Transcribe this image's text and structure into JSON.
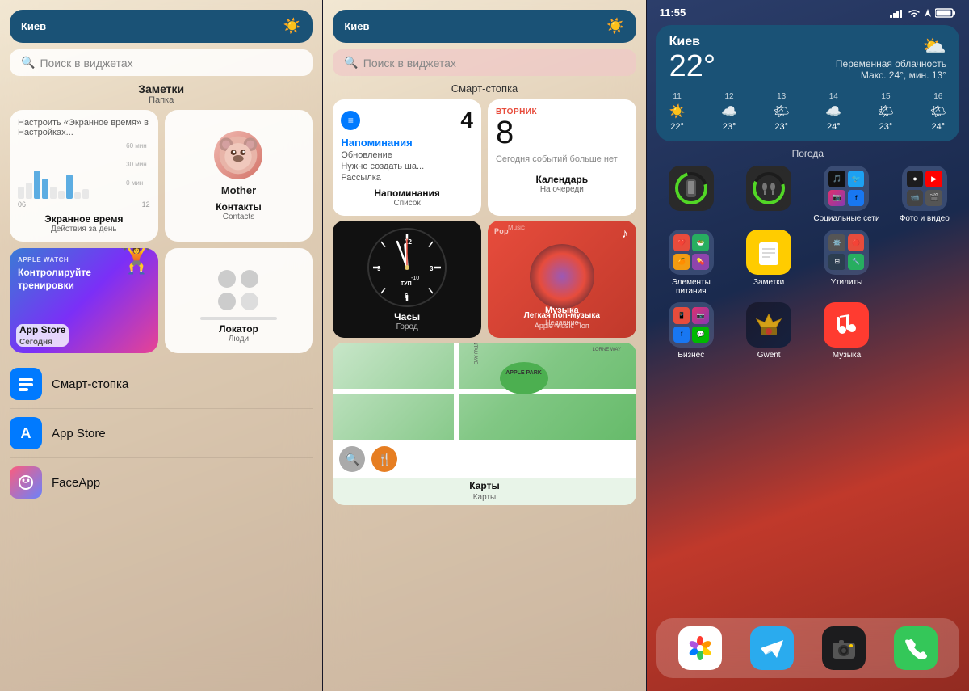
{
  "left_panel": {
    "weather_header": {
      "city": "Киев",
      "icon": "☀️"
    },
    "search": {
      "placeholder": "Поиск в виджетах"
    },
    "notes_folder": {
      "label": "Заметки",
      "sublabel": "Папка"
    },
    "widgets": {
      "screen_time": {
        "title": "Настроить «Экранное время» в Настройках...",
        "label": "Экранное время",
        "sublabel": "Действия за день",
        "time_labels": [
          "60 мин",
          "30 мин",
          "0 мин"
        ],
        "x_labels": [
          "06",
          "12"
        ]
      },
      "contacts": {
        "name": "Mother",
        "label": "Контакты",
        "sublabel": "Contacts"
      },
      "appstore": {
        "badge": "APPLE WATCH",
        "title": "Контролируйте тренировки",
        "label": "App Store",
        "sublabel": "Сегодня"
      },
      "locator": {
        "label": "Локатор",
        "sublabel": "Люди"
      }
    },
    "list_items": [
      {
        "icon": "🗂️",
        "label": "Смарт-стопка",
        "color": "bg-blue"
      },
      {
        "icon": "🅰",
        "label": "App Store",
        "color": "bg-blue"
      },
      {
        "icon": "😊",
        "label": "FaceApp",
        "color": "bg-gradient"
      }
    ]
  },
  "middle_panel": {
    "weather_header": {
      "city": "Киев",
      "icon": "☀️"
    },
    "search": {
      "placeholder": "Поиск в виджетах"
    },
    "section_title": "Смарт-стопка",
    "reminders": {
      "count": "4",
      "title": "Напоминания",
      "items": [
        "Обновление",
        "Нужно создать ша...",
        "Рассылка"
      ],
      "label": "Напоминания",
      "sublabel": "Список"
    },
    "calendar": {
      "day_name": "ВТОРНИК",
      "day_num": "8",
      "no_events": "Сегодня событий больше нет",
      "label": "Календарь",
      "sublabel": "На очереди"
    },
    "clock": {
      "label": "Часы",
      "sublabel": "Город",
      "time": "11:55"
    },
    "music": {
      "title": "Легкая поп-музыка",
      "sublabel": "Apple Music Поп",
      "label": "Музыка",
      "sub": "Недавние"
    },
    "maps": {
      "label": "Карты",
      "sublabel": "Карты"
    }
  },
  "right_panel": {
    "status_bar": {
      "time": "11:55",
      "icons": "▊▊ ▲ 🔋"
    },
    "weather_widget": {
      "city": "Киев",
      "temp": "22°",
      "desc": "Переменная облачность",
      "minmax": "Макс. 24°, мин. 13°",
      "icon": "⛅",
      "label": "Погода",
      "forecast": [
        {
          "day": "11",
          "icon": "☀️",
          "temp": "22°"
        },
        {
          "day": "12",
          "icon": "☁️",
          "temp": "23°"
        },
        {
          "day": "13",
          "icon": "🌤",
          "temp": "23°"
        },
        {
          "day": "14",
          "icon": "☁️",
          "temp": "24°"
        },
        {
          "day": "15",
          "icon": "🌤",
          "temp": "23°"
        },
        {
          "day": "16",
          "icon": "🌤",
          "temp": "24°"
        }
      ]
    },
    "app_rows": [
      [
        {
          "name": "",
          "type": "ring",
          "label": ""
        },
        {
          "name": "",
          "type": "ring2",
          "label": ""
        },
        {
          "name": "social",
          "type": "folder",
          "label": "Социальные сети",
          "color": "rgba(60,80,120,0.7)"
        },
        {
          "name": "photo",
          "type": "folder",
          "label": "Фото и видео",
          "color": "rgba(60,80,120,0.7)"
        }
      ],
      [
        {
          "name": "питание",
          "type": "folder",
          "label": "Элементы питания",
          "color": "rgba(60,80,120,0.7)"
        },
        {
          "name": "notes",
          "type": "app",
          "label": "Заметки",
          "icon": "📝",
          "color": "bg-yellow"
        },
        {
          "name": "utils",
          "type": "folder",
          "label": "Утилиты",
          "color": "rgba(60,80,120,0.7)"
        }
      ],
      [
        {
          "name": "business",
          "type": "folder",
          "label": "Бизнес",
          "color": "rgba(60,80,120,0.7)"
        },
        {
          "name": "gwent",
          "type": "app",
          "label": "Gwent",
          "icon": "⚔️",
          "color": "bg-dark"
        },
        {
          "name": "music",
          "type": "app",
          "label": "Музыка",
          "icon": "🎵",
          "color": "bg-red"
        }
      ]
    ],
    "dock": [
      {
        "name": "photos",
        "icon": "🌈",
        "color": "white",
        "bg": "#fff"
      },
      {
        "name": "telegram",
        "icon": "✈️",
        "color": "white",
        "bg": "#2aabee"
      },
      {
        "name": "camera",
        "icon": "📷",
        "color": "white",
        "bg": "#1c1c1e"
      },
      {
        "name": "phone",
        "icon": "📞",
        "color": "white",
        "bg": "#34c759"
      }
    ]
  }
}
